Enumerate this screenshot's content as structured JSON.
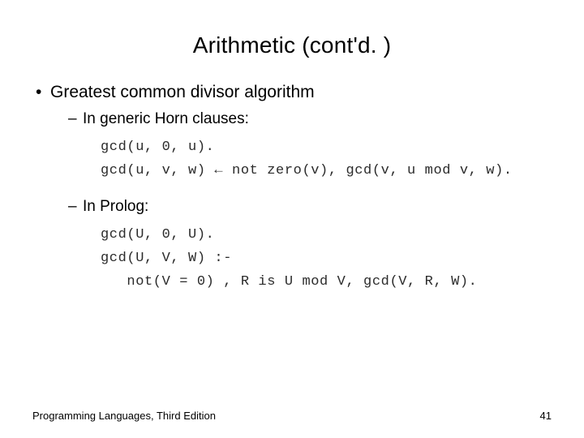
{
  "title": "Arithmetic (cont'd. )",
  "bullets": {
    "main": "Greatest common divisor algorithm",
    "sub1": "In generic Horn clauses:",
    "sub2": "In Prolog:"
  },
  "code": {
    "horn": "gcd(u, 0, u).\ngcd(u, v, w) ← not zero(v), gcd(v, u mod v, w).",
    "prolog": "gcd(U, 0, U).\ngcd(U, V, W) :-\n   not(V = 0) , R is U mod V, gcd(V, R, W)."
  },
  "footer": {
    "left": "Programming Languages, Third Edition",
    "right": "41"
  }
}
